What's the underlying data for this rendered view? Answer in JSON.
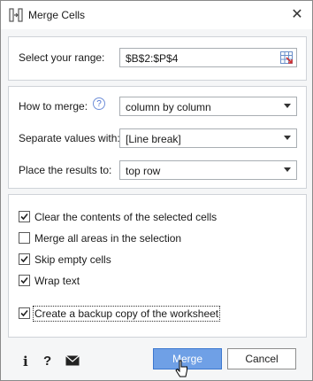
{
  "window": {
    "title": "Merge Cells",
    "title_icon": "merge-cells-icon",
    "close_icon": "close-icon"
  },
  "range": {
    "label": "Select your range:",
    "value": "$B$2:$P$4",
    "icon": "range-select-icon"
  },
  "merge": {
    "how_label": "How to merge:",
    "how_value": "column by column",
    "separator_label": "Separate values with:",
    "separator_value": "[Line break]",
    "place_label": "Place the results to:",
    "place_value": "top row",
    "help_icon": "help-icon"
  },
  "options": [
    {
      "label": "Clear the contents of the selected cells",
      "checked": true
    },
    {
      "label": "Merge all areas in the selection",
      "checked": false
    },
    {
      "label": "Skip empty cells",
      "checked": true
    },
    {
      "label": "Wrap text",
      "checked": true
    },
    {
      "label": "Create a backup copy of the worksheet",
      "checked": true
    }
  ],
  "footer": {
    "info_icon": "info-icon",
    "help_icon": "question-icon",
    "mail_icon": "mail-icon",
    "merge_label": "Merge",
    "cancel_label": "Cancel"
  },
  "colors": {
    "accent": "#6fa0e6",
    "accent_border": "#3d78cf"
  }
}
